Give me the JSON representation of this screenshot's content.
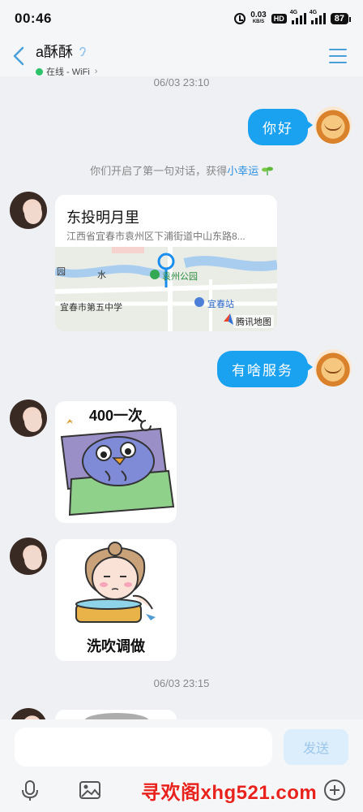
{
  "status_bar": {
    "time": "00:46",
    "net_speed": "0.03",
    "net_unit": "KB/S",
    "hd": "HD",
    "sim1": "4G",
    "sim2": "4G",
    "battery": "87"
  },
  "header": {
    "title": "a酥酥",
    "presence": "在线 - WiFi"
  },
  "messages": {
    "ts1": "06/03 23:10",
    "out1": "你好",
    "system_prefix": "你们开启了第一句对话，获得",
    "system_link": "小幸运",
    "location": {
      "name": "东投明月里",
      "address": "江西省宜春市袁州区下浦街道中山东路8...",
      "map_labels": [
        "袁州公园",
        "宜春市第五中学",
        "宜春站",
        "园",
        "水"
      ],
      "map_attribution": "腾讯地图"
    },
    "out2": "有啥服务",
    "sticker1_caption": "400一次",
    "sticker2_caption": "洗吹调做",
    "ts2": "06/03 23:15"
  },
  "input": {
    "value": "",
    "send_label": "发送"
  },
  "watermark": "寻欢阁xhg521.com",
  "colors": {
    "bubble_out": "#1aa1f0",
    "accent": "#2a8fe0",
    "online": "#2cc36b",
    "watermark": "#e8231e"
  }
}
